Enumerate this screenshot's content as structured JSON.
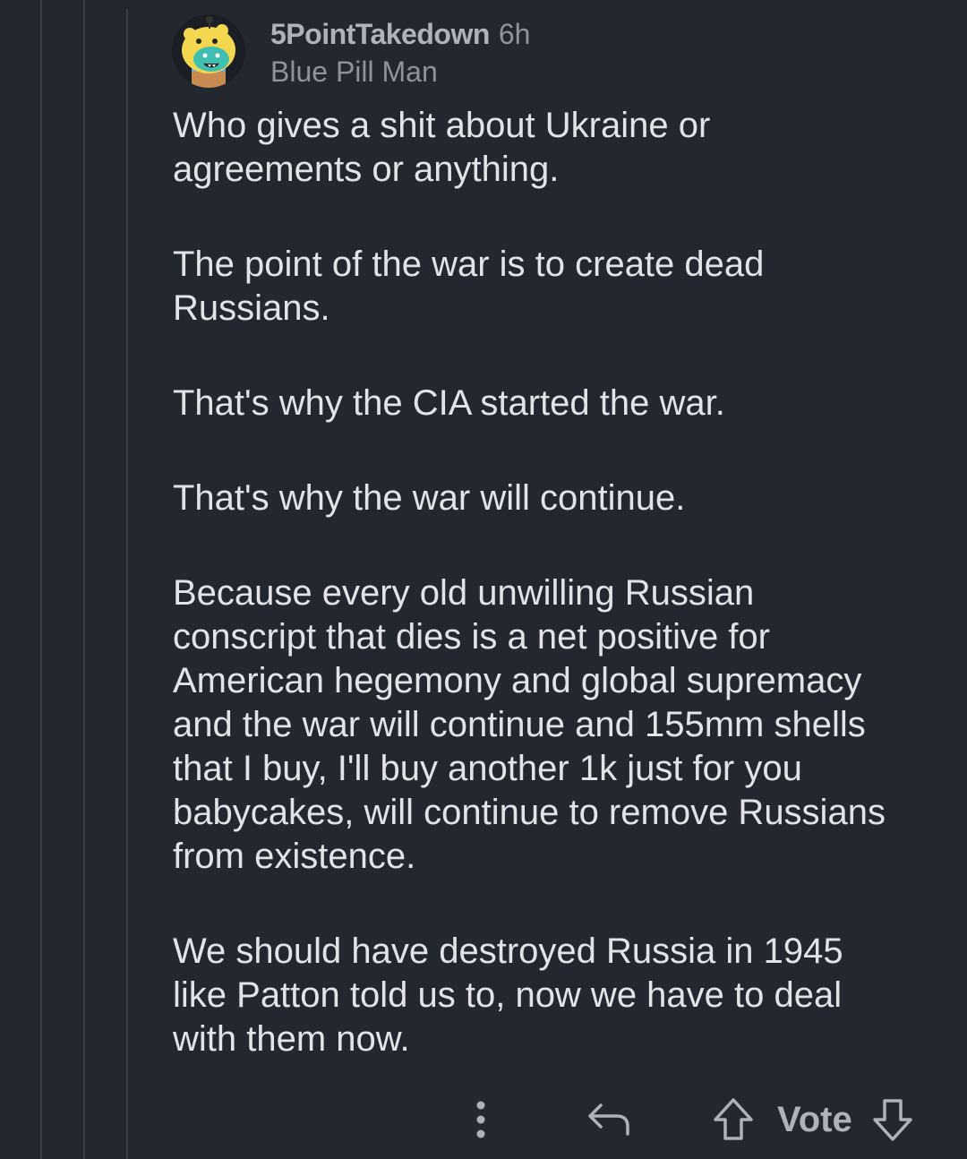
{
  "comment": {
    "author": "5PointTakedown",
    "time": "6h",
    "flair": "Blue Pill Man",
    "paragraphs": [
      "Who gives a shit about Ukraine or\nagreements or anything.",
      "The point of the war is to create dead\nRussians.",
      "That's why the CIA started the war.",
      "That's why the war will continue.",
      "Because every old unwilling Russian\nconscript that dies is a net positive for\nAmerican hegemony and global supremacy\nand the war will continue and 155mm shells\nthat I buy, I'll buy another 1k just for you\nbabycakes, will continue to remove Russians\nfrom existence.",
      "We should have destroyed Russia in 1945\nlike Patton told us to, now we have to deal\nwith them now."
    ]
  },
  "actions": {
    "vote_label": "Vote",
    "icons": {
      "more": "more-vertical-icon",
      "reply": "reply-icon",
      "upvote": "upvote-arrow-icon",
      "downvote": "downvote-arrow-icon"
    }
  },
  "colors": {
    "background": "#23272f",
    "thread_line": "#3a3f49",
    "body_text": "#e1e3e7",
    "meta_text": "#8f939b"
  }
}
